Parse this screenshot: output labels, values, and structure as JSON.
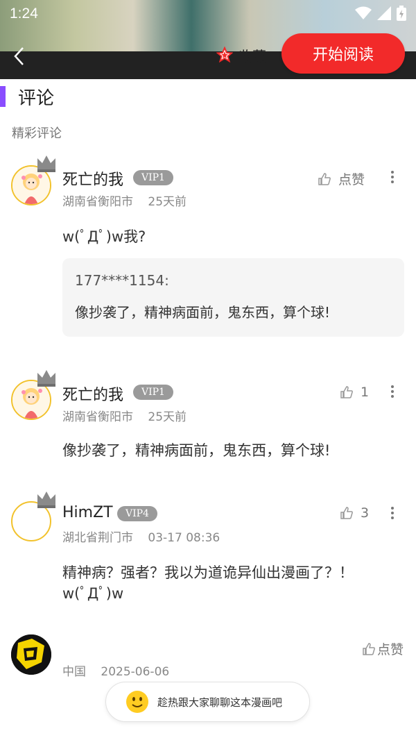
{
  "status_bar": {
    "time": "1:24"
  },
  "header": {
    "collect_label": "收藏",
    "start_read_label": "开始阅读"
  },
  "section": {
    "title": "评论",
    "subtitle": "精彩评论"
  },
  "comments": [
    {
      "user": "死亡的我",
      "vip": "VIP1",
      "location": "湖南省衡阳市",
      "time": "25天前",
      "like": "点赞",
      "text": "w(ﾟДﾟ)w我?",
      "reply": {
        "user": "177****1154:",
        "text": "像抄袭了，精神病面前，鬼东西，算个球!"
      }
    },
    {
      "user": "死亡的我",
      "vip": "VIP1",
      "location": "湖南省衡阳市",
      "time": "25天前",
      "like": "1",
      "text": "像抄袭了，精神病面前，鬼东西，算个球!"
    },
    {
      "user": "HimZT",
      "vip": "VIP4",
      "location": "湖北省荆门市",
      "time": "03-17 08:36",
      "like": "3",
      "text_line1": "精神病？强者？我以为道诡异仙出漫画了？！",
      "text_line2": "w(ﾟДﾟ)w"
    },
    {
      "location": "中国",
      "time": "2025-06-06",
      "like": "点赞"
    }
  ],
  "input": {
    "placeholder": "趁热跟大家聊聊这本漫画吧"
  },
  "colors": {
    "accent_red": "#f22a2a",
    "section_bar": "#8a4dff",
    "avatar_border": "#f2c22c"
  }
}
